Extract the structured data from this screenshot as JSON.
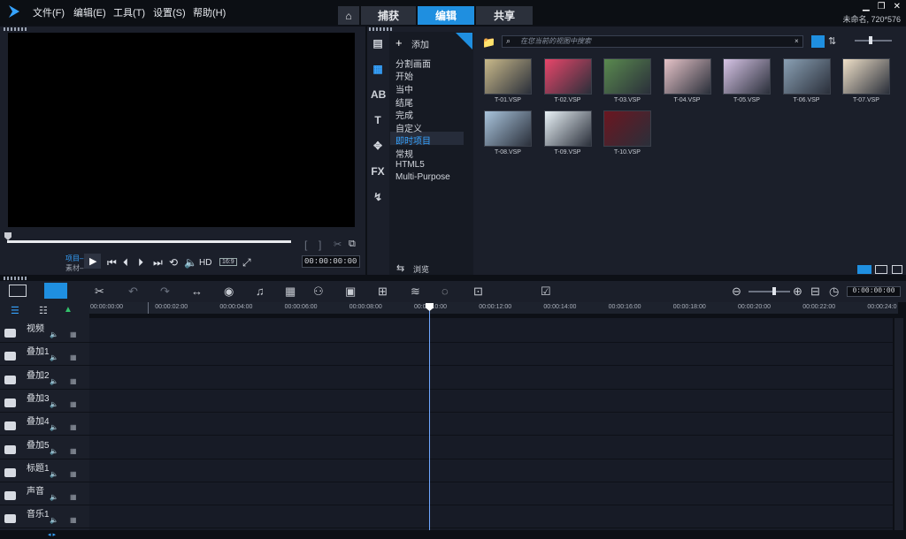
{
  "menu": [
    "文件(F)",
    "编辑(E)",
    "工具(T)",
    "设置(S)",
    "帮助(H)"
  ],
  "tabs": [
    "捕获",
    "编辑",
    "共享"
  ],
  "project_info": "未命名, 720*576",
  "preview": {
    "project_label": "项目–",
    "clip_label": "素材–",
    "hd": "HD",
    "aspect": "16:9",
    "timecode": "00:00:00:00"
  },
  "library": {
    "add_label": "添加",
    "search_placeholder": "在您当前的视图中搜索",
    "browse": "浏览",
    "categories": [
      "分割画面",
      "开始",
      "当中",
      "结尾",
      "完成",
      "自定义",
      "即时项目",
      "常规",
      "HTML5",
      "Multi-Purpose"
    ],
    "thumbs": [
      "T-01.VSP",
      "T-02.VSP",
      "T-03.VSP",
      "T-04.VSP",
      "T-05.VSP",
      "T-06.VSP",
      "T-07.VSP",
      "T-08.VSP",
      "T-09.VSP",
      "T-10.VSP"
    ],
    "thumb_colors": [
      "#c9b98a",
      "#e8466a",
      "#5a8a4f",
      "#e6c3c8",
      "#d7c4e6",
      "#8aa0b4",
      "#efe0c8",
      "#a9c4dc",
      "#e9f2f7",
      "#6b1620"
    ]
  },
  "timeline": {
    "timecode": "0:00:00:00",
    "ticks": [
      "00:00:00:00",
      "00:00:02:00",
      "00:00:04:00",
      "00:00:06:00",
      "00:00:08:00",
      "00:00:10:00",
      "00:00:12:00",
      "00:00:14:00",
      "00:00:16:00",
      "00:00:18:00",
      "00:00:20:00",
      "00:00:22:00",
      "00:00:24:0"
    ],
    "tracks": [
      "视频",
      "叠加1",
      "叠加2",
      "叠加3",
      "叠加4",
      "叠加5",
      "标题1",
      "声音",
      "音乐1"
    ]
  }
}
